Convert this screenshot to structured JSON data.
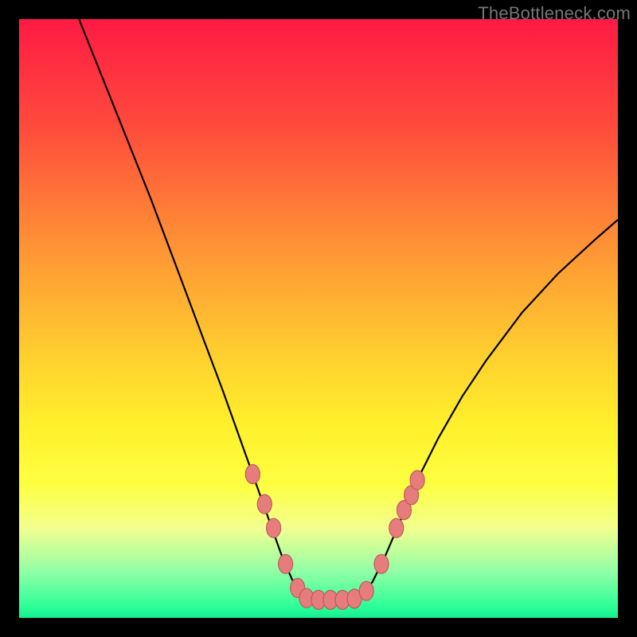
{
  "watermark": "TheBottleneck.com",
  "colors": {
    "gradient_stops": [
      {
        "offset": 0.0,
        "color": "#ff1a44"
      },
      {
        "offset": 0.18,
        "color": "#ff4b3c"
      },
      {
        "offset": 0.4,
        "color": "#ff9a34"
      },
      {
        "offset": 0.58,
        "color": "#ffd52e"
      },
      {
        "offset": 0.68,
        "color": "#fff02c"
      },
      {
        "offset": 0.78,
        "color": "#fdff42"
      },
      {
        "offset": 0.85,
        "color": "#f2ff8f"
      },
      {
        "offset": 0.92,
        "color": "#95ffa6"
      },
      {
        "offset": 0.98,
        "color": "#2fff98"
      },
      {
        "offset": 1.0,
        "color": "#13f08c"
      }
    ],
    "marker_fill": "#e77c7c",
    "marker_stroke": "#bb5b5b",
    "curve": "#000000",
    "frame": "#000000"
  },
  "chart_data": {
    "type": "line",
    "title": "",
    "xlabel": "",
    "ylabel": "",
    "xlim": [
      0,
      100
    ],
    "ylim": [
      0,
      100
    ],
    "comment": "x = normalized horizontal position (0..100), y = severity/metric (0=bottom green band, 100=top red). V-shaped curve with flat minimum segment plus marked sample points near the trough.",
    "curve_points": [
      {
        "x": 10.0,
        "y": 100.0
      },
      {
        "x": 14.0,
        "y": 90.0
      },
      {
        "x": 18.0,
        "y": 80.0
      },
      {
        "x": 22.0,
        "y": 70.0
      },
      {
        "x": 25.0,
        "y": 62.0
      },
      {
        "x": 28.0,
        "y": 54.0
      },
      {
        "x": 31.0,
        "y": 46.0
      },
      {
        "x": 34.0,
        "y": 38.0
      },
      {
        "x": 36.5,
        "y": 31.0
      },
      {
        "x": 39.0,
        "y": 24.0
      },
      {
        "x": 41.5,
        "y": 17.0
      },
      {
        "x": 44.0,
        "y": 10.0
      },
      {
        "x": 46.0,
        "y": 5.5
      },
      {
        "x": 47.5,
        "y": 3.5
      },
      {
        "x": 50.0,
        "y": 3.0
      },
      {
        "x": 52.5,
        "y": 3.0
      },
      {
        "x": 55.0,
        "y": 3.0
      },
      {
        "x": 57.0,
        "y": 3.5
      },
      {
        "x": 59.0,
        "y": 6.0
      },
      {
        "x": 61.0,
        "y": 10.0
      },
      {
        "x": 64.0,
        "y": 17.0
      },
      {
        "x": 67.0,
        "y": 24.0
      },
      {
        "x": 70.0,
        "y": 30.0
      },
      {
        "x": 74.0,
        "y": 37.0
      },
      {
        "x": 78.0,
        "y": 43.0
      },
      {
        "x": 84.0,
        "y": 51.0
      },
      {
        "x": 90.0,
        "y": 57.5
      },
      {
        "x": 96.0,
        "y": 63.0
      },
      {
        "x": 100.0,
        "y": 66.5
      }
    ],
    "markers": [
      {
        "x": 39.0,
        "y": 24.0
      },
      {
        "x": 41.0,
        "y": 19.0
      },
      {
        "x": 42.5,
        "y": 15.0
      },
      {
        "x": 44.5,
        "y": 9.0
      },
      {
        "x": 46.5,
        "y": 5.0
      },
      {
        "x": 48.0,
        "y": 3.3
      },
      {
        "x": 50.0,
        "y": 3.0
      },
      {
        "x": 52.0,
        "y": 3.0
      },
      {
        "x": 54.0,
        "y": 3.0
      },
      {
        "x": 56.0,
        "y": 3.2
      },
      {
        "x": 58.0,
        "y": 4.5
      },
      {
        "x": 60.5,
        "y": 9.0
      },
      {
        "x": 63.0,
        "y": 15.0
      },
      {
        "x": 64.3,
        "y": 18.0
      },
      {
        "x": 65.5,
        "y": 20.5
      },
      {
        "x": 66.5,
        "y": 23.0
      }
    ]
  }
}
